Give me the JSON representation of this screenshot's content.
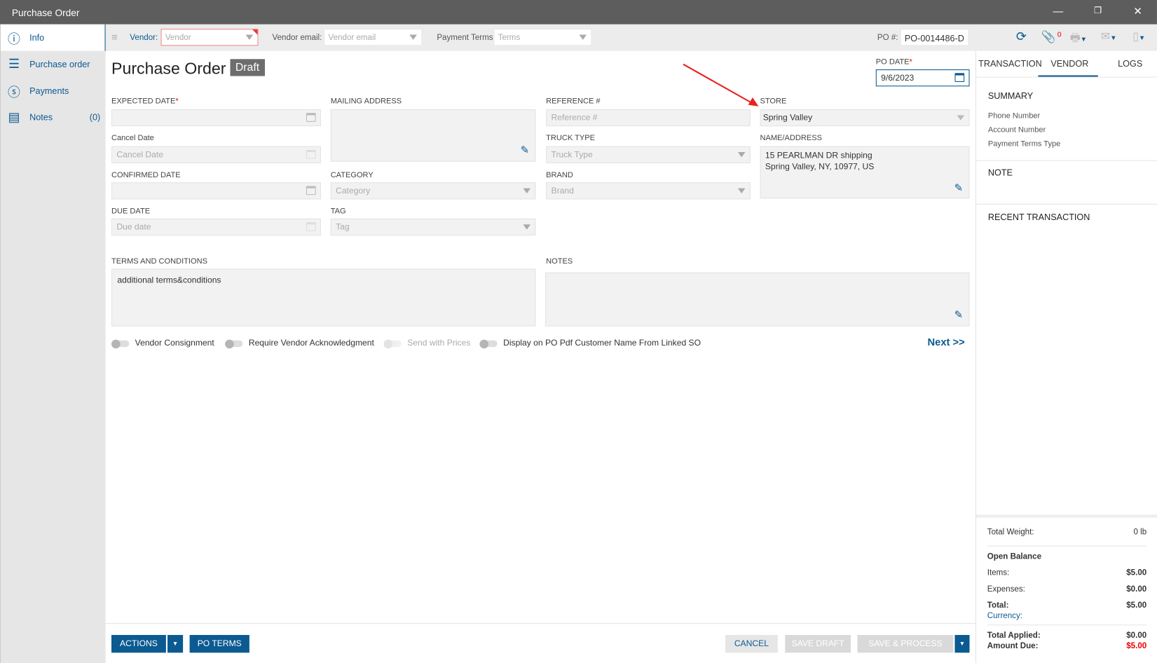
{
  "window": {
    "title": "Purchase Order",
    "minimize": "—",
    "restore": "❐",
    "close": "✕"
  },
  "sidebar": {
    "items": [
      {
        "label": "Info",
        "icon": "info-icon"
      },
      {
        "label": "Purchase order",
        "icon": "list-icon"
      },
      {
        "label": "Payments",
        "icon": "dollar-icon"
      },
      {
        "label": "Notes",
        "icon": "notes-icon",
        "count": "(0)"
      }
    ]
  },
  "toolbar": {
    "vendor_label": "Vendor:",
    "vendor_placeholder": "Vendor",
    "email_label": "Vendor email:",
    "email_placeholder": "Vendor email",
    "terms_label": "Payment Terms:",
    "terms_placeholder": "Terms",
    "po_label": "PO #:",
    "po_number": "PO-0014486-D",
    "attachment_count": "0"
  },
  "header": {
    "title": "Purchase Order",
    "status": "Draft",
    "po_date_label": "PO DATE",
    "po_date": "9/6/2023",
    "required": "*"
  },
  "form": {
    "expected_date_label": "EXPECTED DATE",
    "cancel_date_label": "Cancel Date",
    "cancel_date_placeholder": "Cancel Date",
    "confirmed_date_label": "CONFIRMED DATE",
    "due_date_label": "DUE DATE",
    "due_date_placeholder": "Due date",
    "mailing_address_label": "MAILING ADDRESS",
    "category_label": "CATEGORY",
    "category_placeholder": "Category",
    "tag_label": "TAG",
    "tag_placeholder": "Tag",
    "reference_label": "REFERENCE #",
    "reference_placeholder": "Reference #",
    "truck_type_label": "TRUCK TYPE",
    "truck_type_placeholder": "Truck Type",
    "brand_label": "BRAND",
    "brand_placeholder": "Brand",
    "store_label": "STORE",
    "store_value": "Spring Valley",
    "name_address_label": "NAME/ADDRESS",
    "address_line1": "15 PEARLMAN DR shipping",
    "address_line2": "Spring Valley, NY, 10977, US",
    "terms_label": "TERMS AND CONDITIONS",
    "terms_value": "additional terms&conditions",
    "notes_label": "NOTES"
  },
  "toggles": [
    {
      "label": "Vendor Consignment"
    },
    {
      "label": "Require Vendor Acknowledgment"
    },
    {
      "label": "Send with Prices"
    },
    {
      "label": "Display on PO Pdf Customer Name From Linked SO"
    }
  ],
  "next_label": "Next >>",
  "right_panel": {
    "tabs": [
      "TRANSACTION",
      "VENDOR",
      "LOGS"
    ],
    "summary_title": "SUMMARY",
    "summary_fields": [
      "Phone Number",
      "Account Number",
      "Payment Terms Type"
    ],
    "note_title": "NOTE",
    "recent_title": "RECENT TRANSACTION",
    "total_weight_label": "Total Weight:",
    "total_weight": "0 lb",
    "open_balance": "Open Balance",
    "items_label": "Items:",
    "items": "$5.00",
    "expenses_label": "Expenses:",
    "expenses": "$0.00",
    "total_label": "Total:",
    "total": "$5.00",
    "currency_label": "Currency:",
    "total_applied_label": "Total Applied:",
    "total_applied": "$0.00",
    "amount_due_label": "Amount Due:",
    "amount_due": "$5.00"
  },
  "footer": {
    "actions": "ACTIONS",
    "po_terms": "PO TERMS",
    "cancel": "CANCEL",
    "save_draft": "SAVE DRAFT",
    "save_process": "SAVE & PROCESS"
  },
  "colors": {
    "accent": "#0b5a91",
    "danger": "#e00000"
  }
}
